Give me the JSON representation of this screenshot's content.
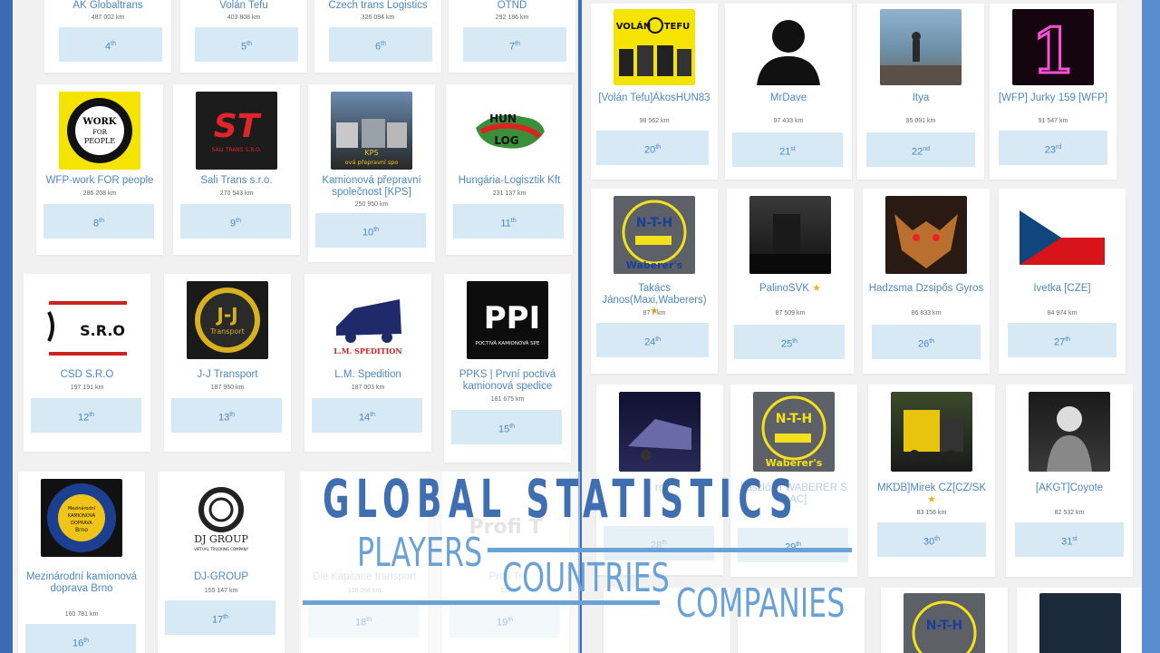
{
  "overlay": {
    "title": "GLOBAL STATISTICS",
    "players": "PLAYERS",
    "countries": "COUNTRIES",
    "companies": "COMPANIES"
  },
  "colors": {
    "accent": "#4d88bf",
    "rank_bg": "#d6e9f5",
    "overlay_title": "#3f6fb1",
    "overlay_sub": "#6aa2d8",
    "star": "#f2b01e"
  },
  "companies": [
    {
      "name": "AK Globaltrans",
      "km": "487 002 km",
      "rank": "4",
      "suffix": "th"
    },
    {
      "name": "Volán Tefu",
      "km": "403 808 km",
      "rank": "5",
      "suffix": "th"
    },
    {
      "name": "Czech trans Logistics",
      "km": "326 094 km",
      "rank": "6",
      "suffix": "th"
    },
    {
      "name": "OTND",
      "km": "292 186 km",
      "rank": "7",
      "suffix": "th"
    },
    {
      "name": "WFP-work FOR people",
      "km": "286 208 km",
      "rank": "8",
      "suffix": "th",
      "logo": "work-for-people-logo",
      "logo_text": [
        "WORK",
        "FOR",
        "PEOPLE"
      ]
    },
    {
      "name": "Sali Trans s.r.o.",
      "km": "270 543 km",
      "rank": "9",
      "suffix": "th",
      "logo": "sali-trans-logo",
      "logo_text": [
        "ST",
        "SALI TRANS S.R.O."
      ]
    },
    {
      "name": "Kamionová přepravní společnost [KPS]",
      "km": "250 950 km",
      "rank": "10",
      "suffix": "th",
      "logo": "kps-trucks-photo",
      "logo_text": [
        "KPS",
        "ová přepravní spo"
      ]
    },
    {
      "name": "Hungária-Logisztik Kft",
      "km": "231 137 km",
      "rank": "11",
      "suffix": "th",
      "logo": "hun-log-logo",
      "logo_text": [
        "HUN",
        "LOG"
      ]
    },
    {
      "name": "CSD S.R.O",
      "km": "197 191 km",
      "rank": "12",
      "suffix": "th",
      "logo": "csd-logo",
      "logo_text": [
        "S.R.O"
      ]
    },
    {
      "name": "J-J Transport",
      "km": "187 950 km",
      "rank": "13",
      "suffix": "th",
      "logo": "jj-transport-logo",
      "logo_text": [
        "Transport"
      ]
    },
    {
      "name": "L.M. Spedition",
      "km": "187 003 km",
      "rank": "14",
      "suffix": "th",
      "logo": "lm-spedition-logo",
      "logo_text": [
        "L.M. SPEDITION"
      ]
    },
    {
      "name": "PPKS | První poctivá kamionová spedice",
      "km": "181 675 km",
      "rank": "15",
      "suffix": "th",
      "logo": "ppks-logo",
      "logo_text": [
        "PPI",
        "POCTIVÁ KAMIONOVÁ SPE"
      ]
    },
    {
      "name": "Mezinárodní kamionová doprava Brno",
      "km": "160 781 km",
      "rank": "16",
      "suffix": "th",
      "logo": "mkd-brno-logo",
      "logo_text": [
        "Mezinárodní",
        "KAMIONOVÁ",
        "DOPRAVA",
        "Brno"
      ]
    },
    {
      "name": "DJ-GROUP",
      "km": "155 147 km",
      "rank": "17",
      "suffix": "th",
      "logo": "dj-group-logo",
      "logo_text": [
        "DJ GROUP",
        "VIRTUAL TRUCKING COMPANY"
      ]
    },
    {
      "name": "Die Kapitane transport",
      "km": "138 064 km",
      "rank": "18",
      "suffix": "th"
    },
    {
      "name": "Profi Tr",
      "km": "127",
      "rank": "19",
      "suffix": "th",
      "logo": "profi-logo",
      "logo_text": [
        "Profi T"
      ]
    }
  ],
  "players": [
    {
      "name": "[Volán Tefu]ÁkosHUN83",
      "km": "98 562 km",
      "rank": "20",
      "suffix": "th",
      "logo": "volan-tefu-avatar",
      "logo_text": [
        "VOLÁN",
        "TEFU"
      ]
    },
    {
      "name": "MrDave",
      "km": "97 433 km",
      "rank": "21",
      "suffix": "st",
      "logo": "default-avatar"
    },
    {
      "name": "Itya",
      "km": "95 091 km",
      "rank": "22",
      "suffix": "nd",
      "logo": "photo-avatar"
    },
    {
      "name": "[WFP] Jurky 159 [WFP]",
      "km": "91 547 km",
      "rank": "23",
      "suffix": "rd",
      "logo": "neon-one-avatar",
      "logo_text": [
        "1"
      ]
    },
    {
      "name": "Takács János(Maxi,Waberers)",
      "km": "87 7  km",
      "rank": "24",
      "suffix": "th",
      "logo": "nth-waberers-avatar",
      "logo_text": [
        "N-T-H",
        "Waberer's"
      ]
    },
    {
      "name": "PalinoSVK",
      "km": "87 509 km",
      "rank": "25",
      "suffix": "th",
      "logo": "dark-truck-avatar"
    },
    {
      "name": "Hadzsma Dzsipős Gyros",
      "km": "86 833 km",
      "rank": "26",
      "suffix": "th",
      "logo": "creature-avatar"
    },
    {
      "name": "Ivetka [CZE]",
      "km": "84 974 km",
      "rank": "27",
      "suffix": "th",
      "logo": "czech-flag-avatar"
    },
    {
      "name": "      ro",
      "km": "",
      "rank": "28",
      "suffix": "th",
      "logo": "night-truck-avatar"
    },
    {
      "name": "László ef WABERER S [LAC]",
      "km": "",
      "rank": "29",
      "suffix": "th",
      "logo": "nth-waberers-avatar",
      "logo_text": [
        "N-T-H",
        "Waberer's"
      ]
    },
    {
      "name": "MKDB]Mirek CZ[CZ/SK",
      "km": "83 156 km",
      "rank": "30",
      "suffix": "th",
      "logo": "yellow-truck-avatar"
    },
    {
      "name": "[AKGT]Coyote",
      "km": "82 532 km",
      "rank": "31",
      "suffix": "st",
      "logo": "coyote-avatar"
    }
  ]
}
